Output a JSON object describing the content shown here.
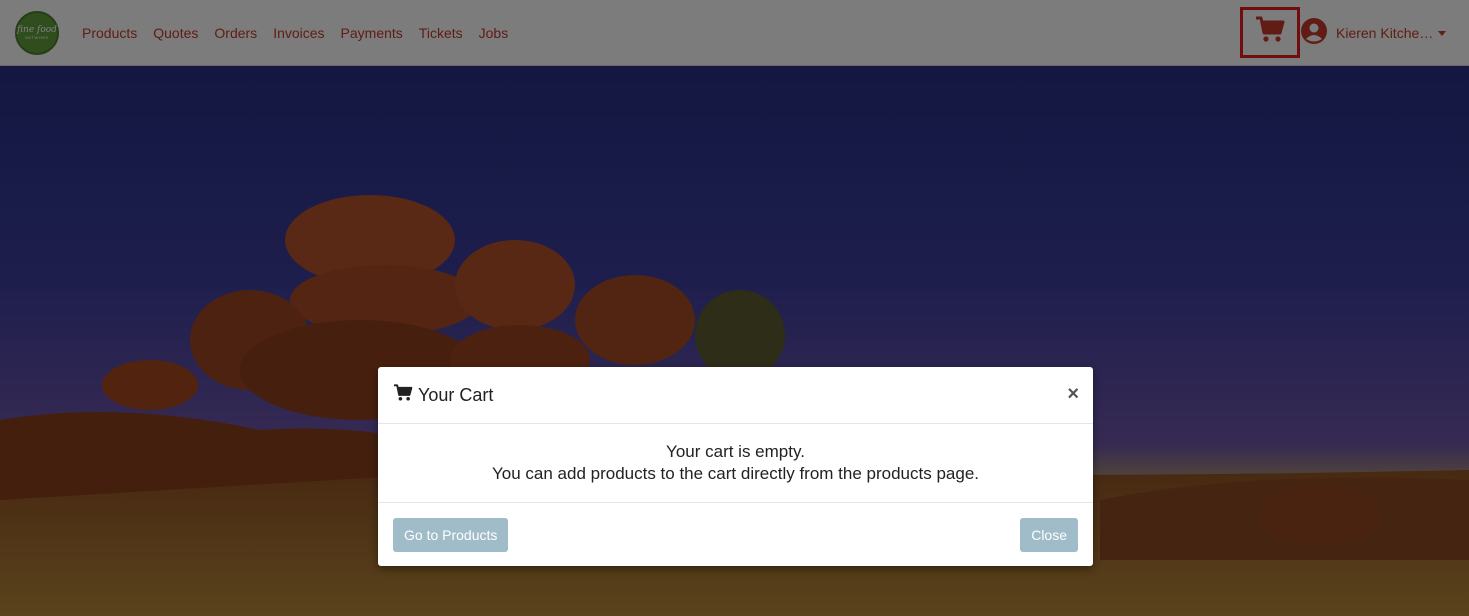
{
  "brand": {
    "logo_line1": "fine food",
    "logo_line2": "NETWORK"
  },
  "nav": {
    "items": [
      {
        "label": "Products"
      },
      {
        "label": "Quotes"
      },
      {
        "label": "Orders"
      },
      {
        "label": "Invoices"
      },
      {
        "label": "Payments"
      },
      {
        "label": "Tickets"
      },
      {
        "label": "Jobs"
      }
    ]
  },
  "header": {
    "cart_icon": "shopping-cart-icon",
    "user_icon": "user-circle-icon",
    "user_name": "Kieren Kitche…"
  },
  "modal": {
    "title": "Your Cart",
    "title_icon": "shopping-cart-icon",
    "close_symbol": "×",
    "message_line1": "Your cart is empty.",
    "message_line2": "You can add products to the cart directly from the products page.",
    "primary_button": "Go to Products",
    "secondary_button": "Close"
  },
  "colors": {
    "nav_link": "#c0392b",
    "highlight_border": "#e31b1b",
    "button_bg": "#9fbcc8"
  }
}
